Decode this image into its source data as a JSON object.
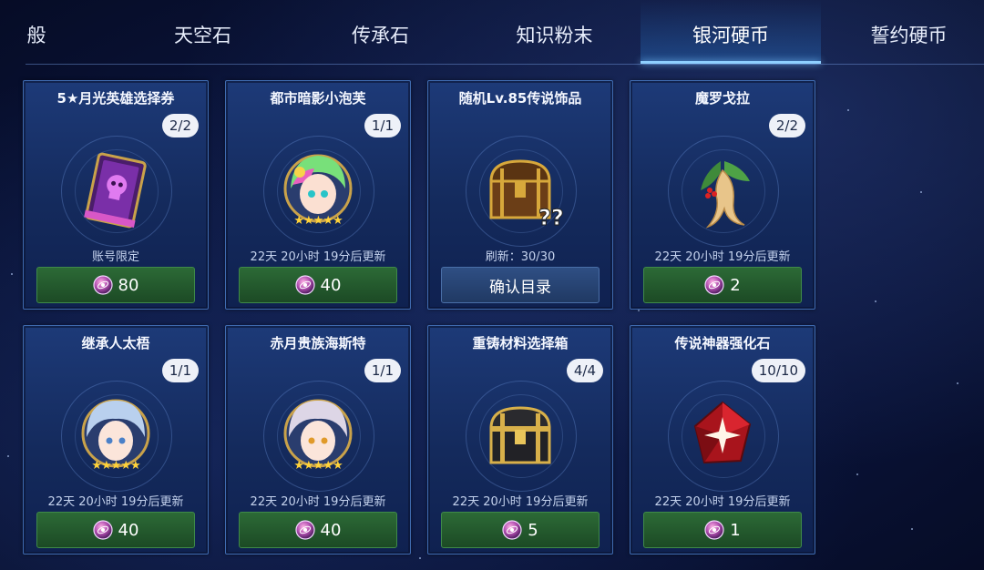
{
  "tabs": [
    {
      "label": "般"
    },
    {
      "label": "天空石"
    },
    {
      "label": "传承石"
    },
    {
      "label": "知识粉末"
    },
    {
      "label": "银河硬币",
      "active": true
    },
    {
      "label": "誓约硬币"
    }
  ],
  "colors": {
    "accent": "#8fd0ff",
    "buy_button": "#2c6a36",
    "confirm_button": "#2f4f84"
  },
  "cards": [
    {
      "title": "5★月光英雄选择券",
      "count": "2/2",
      "status": "账号限定",
      "price": "80",
      "icon": "purple-skull-book-icon"
    },
    {
      "title": "都市暗影小泡芙",
      "count": "1/1",
      "status": "22天 20小时 19分后更新",
      "price": "40",
      "icon": "hero-portrait-green-hair-icon",
      "stars": "★★★★★"
    },
    {
      "title": "随机Lv.85传说饰品",
      "count": "",
      "status": "刷新：30/30",
      "button": "确认目录",
      "icon": "mystery-chest-icon"
    },
    {
      "title": "魔罗戈拉",
      "count": "2/2",
      "status": "22天 20小时 19分后更新",
      "price": "2",
      "icon": "mandragora-root-icon"
    },
    {
      "title": "继承人太梧",
      "count": "1/1",
      "status": "22天 20小时 19分后更新",
      "price": "40",
      "icon": "hero-portrait-blue-hair-icon",
      "stars": "★★★★★"
    },
    {
      "title": "赤月贵族海斯特",
      "count": "1/1",
      "status": "22天 20小时 19分后更新",
      "price": "40",
      "icon": "hero-portrait-white-hair-icon",
      "stars": "★★★★★"
    },
    {
      "title": "重铸材料选择箱",
      "count": "4/4",
      "status": "22天 20小时 19分后更新",
      "price": "5",
      "icon": "gold-chest-icon"
    },
    {
      "title": "传说神器强化石",
      "count": "10/10",
      "status": "22天 20小时 19分后更新",
      "price": "1",
      "icon": "red-gem-icon"
    }
  ]
}
